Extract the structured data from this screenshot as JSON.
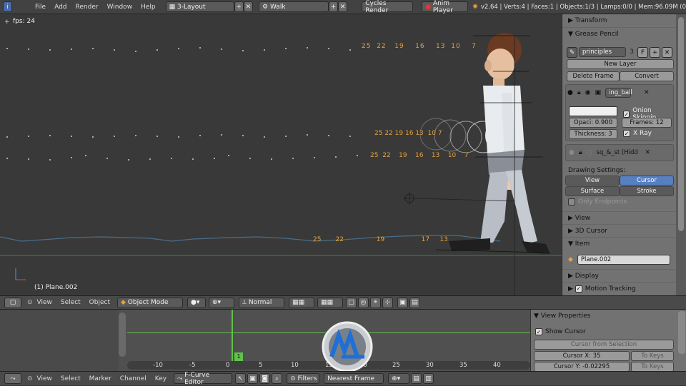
{
  "topbar": {
    "menus": [
      "File",
      "Add",
      "Render",
      "Window",
      "Help"
    ],
    "layout": "3-Layout",
    "scene": "Walk",
    "engine": "Cycles Render",
    "anim_player": "Anim Player",
    "stats": "v2.64 | Verts:4 | Faces:1 | Objects:1/3 | Lamps:0/0 | Mem:96.09M (0"
  },
  "viewport": {
    "fps": "fps: 24",
    "object_label": "(1) Plane.002",
    "frame_numbers_top": [
      "25",
      "22",
      "19",
      "16",
      "13",
      "10",
      "7"
    ],
    "frame_numbers_mid": [
      "25",
      "22",
      "19",
      "16",
      "13",
      "10",
      "7"
    ],
    "frame_numbers_low": [
      "25",
      "22",
      "19",
      "16",
      "13",
      "10",
      "7"
    ],
    "frame_numbers_bottom": [
      "25",
      "22",
      "19",
      "17",
      "13"
    ]
  },
  "npanel": {
    "transform": "Transform",
    "grease_pencil": "Grease Pencil",
    "gp_name": "principles",
    "gp_users": "3",
    "gp_f": "F",
    "new_layer": "New Layer",
    "delete_frame": "Delete Frame",
    "convert": "Convert",
    "layer1_name": "ing_ball",
    "onion": "Onion Skinnin",
    "opacity": "Opaci: 0.900",
    "frames": "Frames: 12",
    "thickness": "Thickness: 3",
    "xray": "X Ray",
    "layer2_name": "sq_&_st (Hidde",
    "drawing_settings": "Drawing Settings:",
    "draw_view": "View",
    "draw_cursor": "Cursor",
    "draw_surface": "Surface",
    "draw_stroke": "Stroke",
    "only_endpoints": "Only Endpoints",
    "view": "View",
    "cursor3d": "3D Cursor",
    "item": "Item",
    "item_name": "Plane.002",
    "display": "Display",
    "motion_tracking": "Motion Tracking",
    "accent_color": "#5680c2"
  },
  "header3d": {
    "menus": [
      "View",
      "Select",
      "Object"
    ],
    "mode": "Object Mode",
    "orientation": "Normal"
  },
  "graph": {
    "ticks": [
      "-10",
      "-5",
      "0",
      "5",
      "10",
      "15",
      "20",
      "25",
      "30",
      "35",
      "40"
    ],
    "current_frame": "1"
  },
  "graph_props": {
    "title": "View Properties",
    "show_cursor": "Show Cursor",
    "cursor_from_selection": "Cursor from Selection",
    "cursor_x": "Cursor X: 35",
    "cursor_y": "Cursor Y: -0.02295",
    "to_keys": "To Keys"
  },
  "header_graph": {
    "menus": [
      "View",
      "Select",
      "Marker",
      "Channel",
      "Key"
    ],
    "editor": "F-Curve Editor",
    "filters": "Filters",
    "pivot": "Nearest Frame"
  }
}
